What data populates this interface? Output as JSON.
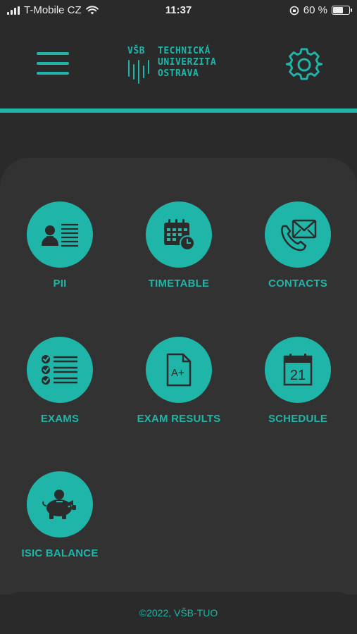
{
  "status_bar": {
    "carrier": "T-Mobile CZ",
    "time": "11:37",
    "battery": "60 %",
    "battery_level": 0.6
  },
  "header": {
    "logo": {
      "vsb": "VŠB",
      "line1": "TECHNICKÁ",
      "line2": "UNIVERZITA",
      "line3": "OSTRAVA"
    },
    "menu_icon": "hamburger-icon",
    "settings_icon": "gear-icon"
  },
  "tiles": [
    {
      "label": "PII",
      "icon": "id-card-icon"
    },
    {
      "label": "TIMETABLE",
      "icon": "calendar-clock-icon"
    },
    {
      "label": "CONTACTS",
      "icon": "phone-mail-icon"
    },
    {
      "label": "EXAMS",
      "icon": "checklist-icon"
    },
    {
      "label": "EXAM RESULTS",
      "icon": "graded-document-icon"
    },
    {
      "label": "SCHEDULE",
      "icon": "calendar-day-icon",
      "day": "21"
    },
    {
      "label": "ISIC BALANCE",
      "icon": "piggy-bank-icon"
    }
  ],
  "footer": {
    "text": "©2022, VŠB-TUO"
  },
  "colors": {
    "accent": "#1fb5a8",
    "background": "#2a2a2a",
    "panel": "#323232",
    "icon_dark": "#2b2b2b"
  }
}
